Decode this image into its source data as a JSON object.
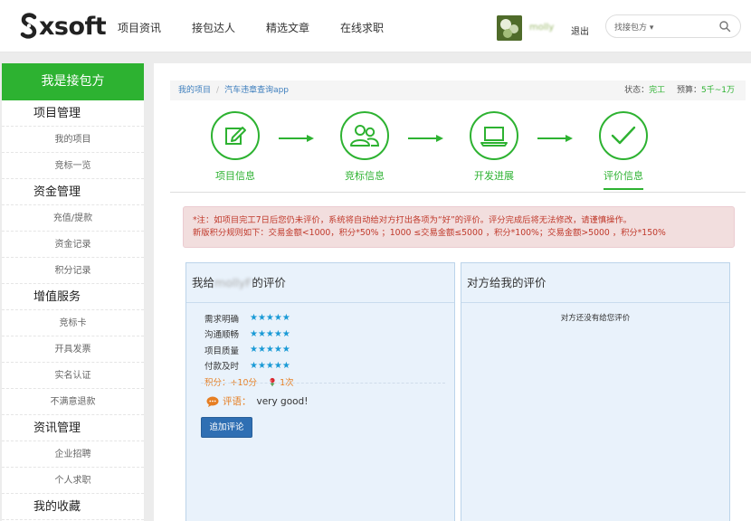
{
  "header": {
    "logo_text": "xsoft",
    "nav": [
      "项目资讯",
      "接包达人",
      "精选文章",
      "在线求职"
    ],
    "username": "molly",
    "logout": "退出",
    "search": {
      "type_label": "找接包方 ▾",
      "placeholder": ""
    }
  },
  "sidebar": {
    "title": "我是接包方",
    "groups": [
      {
        "label": "项目管理",
        "items": [
          "我的项目",
          "竞标一览"
        ]
      },
      {
        "label": "资金管理",
        "items": [
          "充值/提款",
          "资金记录",
          "积分记录"
        ]
      },
      {
        "label": "增值服务",
        "items": [
          "竞标卡",
          "开具发票",
          "实名认证",
          "不满意退款"
        ]
      },
      {
        "label": "资讯管理",
        "items": [
          "企业招聘",
          "个人求职"
        ]
      },
      {
        "label": "我的收藏",
        "items": []
      }
    ]
  },
  "breadcrumb": {
    "items": [
      "我的项目",
      "汽车违章查询app"
    ],
    "separator": "/",
    "status_label": "状态：",
    "status_value": "完工",
    "budget_label": "预算：",
    "budget_value": "5千~1万"
  },
  "steps": [
    {
      "label": "项目信息",
      "icon": "edit-icon"
    },
    {
      "label": "竞标信息",
      "icon": "users-icon"
    },
    {
      "label": "开发进展",
      "icon": "laptop-icon"
    },
    {
      "label": "评价信息",
      "icon": "check-icon",
      "active": true
    }
  ],
  "notice": {
    "line1": "*注：如项目完工7日后您仍未评价，系统将自动给对方打出各项为“好”的评价。评分完成后将无法修改，请谨慎操作。",
    "line2": "新版积分规则如下：交易金额<1000，积分*50% ；1000 ≤交易金额≤5000 ，积分*100%；交易金额>5000 ，积分*150%"
  },
  "my_review": {
    "title_prefix": "我给",
    "title_name": "mollyF",
    "title_suffix": "的评价",
    "ratings": [
      {
        "name": "需求明确",
        "stars": "★★★★★"
      },
      {
        "name": "沟通顺畅",
        "stars": "★★★★★"
      },
      {
        "name": "项目质量",
        "stars": "★★★★★"
      },
      {
        "name": "付款及时",
        "stars": "★★★★★"
      }
    ],
    "score_label": "积分：+10分",
    "flower_count": "1次",
    "comment_label": "评语：",
    "comment_text": "very good!",
    "add_button": "追加评论"
  },
  "their_review": {
    "title": "对方给我的评价",
    "empty_text": "对方还没有给您评价"
  },
  "colors": {
    "green": "#2db231",
    "blue_button": "#2f6fb3",
    "star": "#1a9ad6",
    "orange": "#e67e22"
  }
}
